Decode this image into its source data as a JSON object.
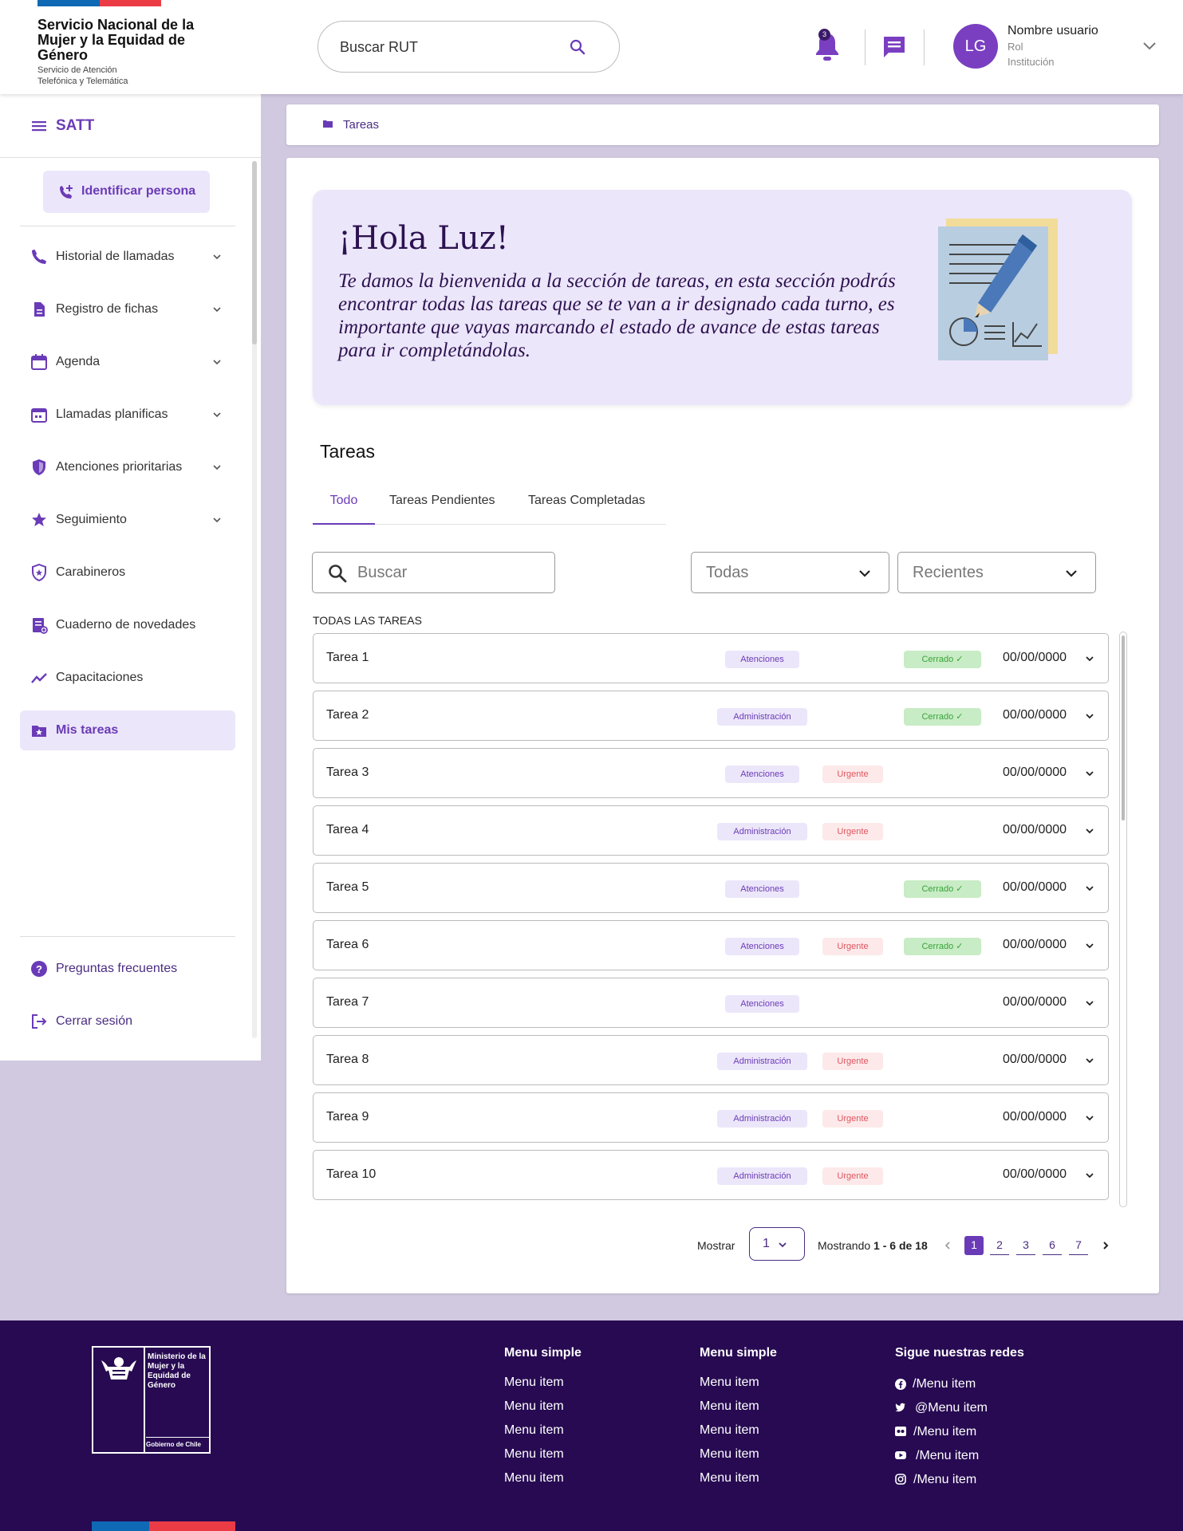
{
  "header": {
    "org_name": "Servicio Nacional de la Mujer y la Equidad de Género",
    "org_sub": "Servicio de Atención Telefónica y Telemática",
    "search_placeholder": "Buscar RUT",
    "notification_count": "3",
    "user": {
      "initials": "LG",
      "name": "Nombre usuario",
      "role": "Rol",
      "institution": "Institución"
    }
  },
  "sidebar": {
    "title": "SATT",
    "identify_button": "Identificar persona",
    "items": [
      {
        "label": "Historial de llamadas",
        "icon": "phone-icon",
        "expandable": true
      },
      {
        "label": "Registro de fichas",
        "icon": "document-icon",
        "expandable": true
      },
      {
        "label": "Agenda",
        "icon": "calendar-icon",
        "expandable": true
      },
      {
        "label": "Llamadas planificas",
        "icon": "calendar-event-icon",
        "expandable": true
      },
      {
        "label": "Atenciones prioritarias",
        "icon": "shield-icon",
        "expandable": true
      },
      {
        "label": "Seguimiento",
        "icon": "star-icon",
        "expandable": true
      },
      {
        "label": "Carabineros",
        "icon": "police-shield-icon",
        "expandable": false
      },
      {
        "label": "Cuaderno de novedades",
        "icon": "notebook-icon",
        "expandable": false
      },
      {
        "label": "Capacitaciones",
        "icon": "trending-icon",
        "expandable": false
      },
      {
        "label": "Mis tareas",
        "icon": "folder-star-icon",
        "expandable": false,
        "active": true
      }
    ],
    "bottom_items": [
      {
        "label": "Preguntas frecuentes",
        "icon": "help-icon"
      },
      {
        "label": "Cerrar sesión",
        "icon": "logout-icon"
      }
    ]
  },
  "breadcrumb": {
    "label": "Tareas"
  },
  "banner": {
    "greeting": "¡Hola Luz!",
    "message": "Te damos la bienvenida a  la sección de tareas, en esta sección podrás encontrar todas las tareas que se te van a ir designado cada turno, es importante que vayas marcando el estado de avance de estas tareas para ir completándolas."
  },
  "tasks_section": {
    "title": "Tareas",
    "tabs": [
      "Todo",
      "Tareas Pendientes",
      "Tareas Completadas"
    ],
    "active_tab": 0,
    "search_placeholder": "Buscar",
    "filter_status": "Todas",
    "filter_order": "Recientes",
    "list_label": "TODAS LAS TAREAS",
    "tasks": [
      {
        "name": "Tarea 1",
        "category": "Atenciones",
        "urgent": false,
        "closed": true,
        "date": "00/00/0000"
      },
      {
        "name": "Tarea 2",
        "category": "Administración",
        "urgent": false,
        "closed": true,
        "date": "00/00/0000"
      },
      {
        "name": "Tarea 3",
        "category": "Atenciones",
        "urgent": true,
        "closed": false,
        "date": "00/00/0000"
      },
      {
        "name": "Tarea 4",
        "category": "Administración",
        "urgent": true,
        "closed": false,
        "date": "00/00/0000"
      },
      {
        "name": "Tarea 5",
        "category": "Atenciones",
        "urgent": false,
        "closed": true,
        "date": "00/00/0000"
      },
      {
        "name": "Tarea 6",
        "category": "Atenciones",
        "urgent": true,
        "closed": true,
        "date": "00/00/0000"
      },
      {
        "name": "Tarea 7",
        "category": "Atenciones",
        "urgent": false,
        "closed": false,
        "date": "00/00/0000"
      },
      {
        "name": "Tarea 8",
        "category": "Administración",
        "urgent": true,
        "closed": false,
        "date": "00/00/0000"
      },
      {
        "name": "Tarea 9",
        "category": "Administración",
        "urgent": true,
        "closed": false,
        "date": "00/00/0000"
      },
      {
        "name": "Tarea 10",
        "category": "Administración",
        "urgent": true,
        "closed": false,
        "date": "00/00/0000"
      }
    ],
    "urgent_label": "Urgente",
    "closed_label": "Cerrado ✓",
    "pagination": {
      "show_label": "Mostrar",
      "page_size": "1",
      "showing_prefix": "Mostrando ",
      "showing_range": "1 - 6 de 18",
      "pages": [
        "1",
        "2",
        "3",
        "6",
        "7"
      ],
      "current_page": "1"
    }
  },
  "footer": {
    "ministry": "Ministerio de la Mujer y la Equidad de Género",
    "government": "Gobierno de Chile",
    "columns": [
      {
        "title": "Menu simple",
        "items": [
          "Menu item",
          "Menu item",
          "Menu item",
          "Menu item",
          "Menu item"
        ]
      },
      {
        "title": "Menu simple",
        "items": [
          "Menu item",
          "Menu item",
          "Menu item",
          "Menu item",
          "Menu item"
        ]
      }
    ],
    "social": {
      "title": "Sigue nuestras redes",
      "items": [
        {
          "label": "/Menu item",
          "icon": "facebook-icon"
        },
        {
          "label": "@Menu item",
          "icon": "twitter-icon"
        },
        {
          "label": "/Menu item",
          "icon": "flickr-icon"
        },
        {
          "label": "/Menu item",
          "icon": "youtube-icon"
        },
        {
          "label": "/Menu item",
          "icon": "instagram-icon"
        }
      ]
    }
  },
  "colors": {
    "primary": "#6a3bb7",
    "dark_purple": "#270a52",
    "page_bg": "#d1c9e0",
    "banner_bg": "#ece6fa",
    "urgent": "#e05560",
    "closed": "#3aa43a"
  }
}
